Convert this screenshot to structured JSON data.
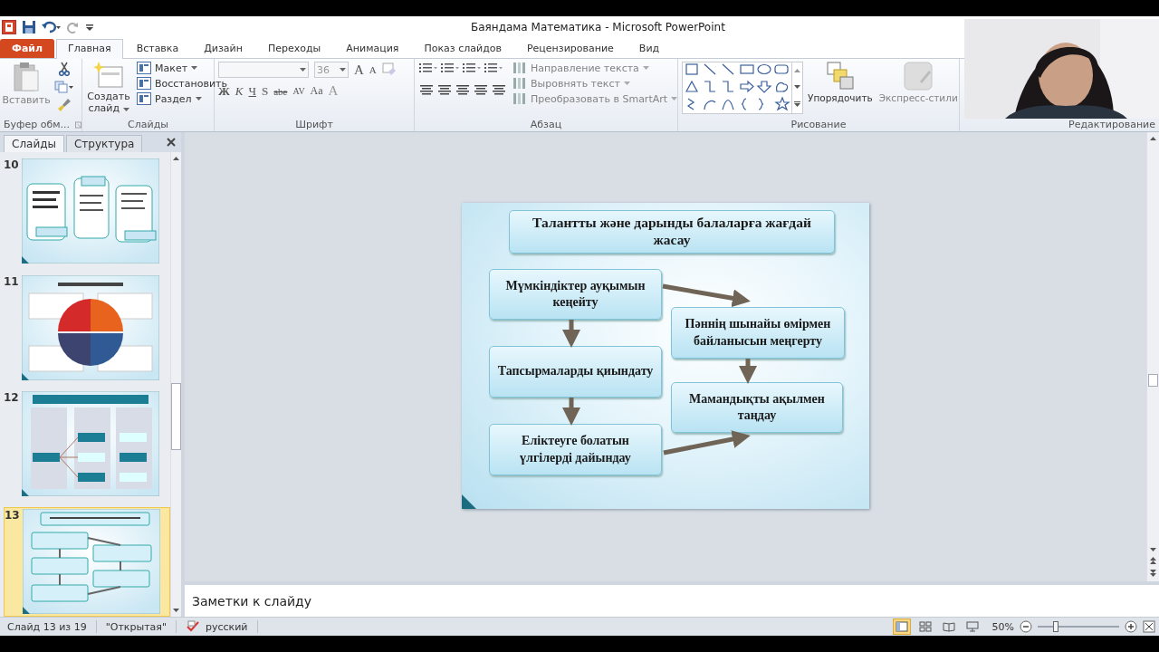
{
  "window": {
    "title": "Баяндама  Математика  -  Microsoft PowerPoint"
  },
  "ribbon_tabs": [
    {
      "label": "Файл",
      "kind": "file",
      "selected": false
    },
    {
      "label": "Главная",
      "kind": "tab",
      "selected": true
    },
    {
      "label": "Вставка",
      "kind": "tab",
      "selected": false
    },
    {
      "label": "Дизайн",
      "kind": "tab",
      "selected": false
    },
    {
      "label": "Переходы",
      "kind": "tab",
      "selected": false
    },
    {
      "label": "Анимация",
      "kind": "tab",
      "selected": false
    },
    {
      "label": "Показ слайдов",
      "kind": "tab",
      "selected": false
    },
    {
      "label": "Рецензирование",
      "kind": "tab",
      "selected": false
    },
    {
      "label": "Вид",
      "kind": "tab",
      "selected": false
    }
  ],
  "ribbon": {
    "clipboard": {
      "paste": "Вставить",
      "label": "Буфер обм..."
    },
    "slides": {
      "new_slide": "Создать слайд",
      "commands": [
        "Макет",
        "Восстановить",
        "Раздел"
      ],
      "label": "Слайды"
    },
    "font": {
      "size": "36",
      "size_buttons": [
        "A",
        "A"
      ],
      "buttons": [
        "Ж",
        "К",
        "Ч",
        "S",
        "abe",
        "AV",
        "Aa",
        "A"
      ],
      "label": "Шрифт"
    },
    "paragraph": {
      "commands": [
        {
          "label": "Направление текста",
          "disabled": true
        },
        {
          "label": "Выровнять текст",
          "disabled": true
        },
        {
          "label": "Преобразовать в SmartArt",
          "disabled": true
        }
      ],
      "label": "Абзац"
    },
    "drawing": {
      "commands": [
        {
          "label": "Упорядочить",
          "disabled": false
        },
        {
          "label": "Экспресс-стили",
          "disabled": true
        }
      ],
      "label": "Рисование"
    },
    "editing": {
      "label": "Редактирование"
    }
  },
  "panel": {
    "tabs": [
      {
        "label": "Слайды",
        "selected": true
      },
      {
        "label": "Структура",
        "selected": false
      }
    ],
    "thumbnails": [
      {
        "number": "10",
        "kind": "columns",
        "selected": false
      },
      {
        "number": "11",
        "kind": "circle",
        "selected": false
      },
      {
        "number": "12",
        "kind": "table",
        "selected": false
      },
      {
        "number": "13",
        "kind": "flowchart",
        "selected": true
      }
    ]
  },
  "slide": {
    "title": "Талантты және дарынды балаларға жағдай жасау",
    "boxes": [
      "Мүмкіндіктер ауқымын кеңейту",
      "Тапсырмаларды қиындату",
      "Еліктеуге болатын үлгілерді дайындау",
      "Пәннің шынайы өмірмен байланысын меңгерту",
      "Мамандықты ақылмен таңдау"
    ]
  },
  "notes": {
    "placeholder": "Заметки к слайду"
  },
  "status_bar": {
    "slide_info": "Слайд 13 из 19",
    "theme": "\"Открытая\"",
    "language": "русский",
    "views": [
      {
        "kind": "normal",
        "selected": true
      },
      {
        "kind": "sorter",
        "selected": false
      },
      {
        "kind": "reading",
        "selected": false
      },
      {
        "kind": "show",
        "selected": false
      }
    ],
    "zoom": {
      "label": "50%",
      "level": 0.22
    }
  }
}
